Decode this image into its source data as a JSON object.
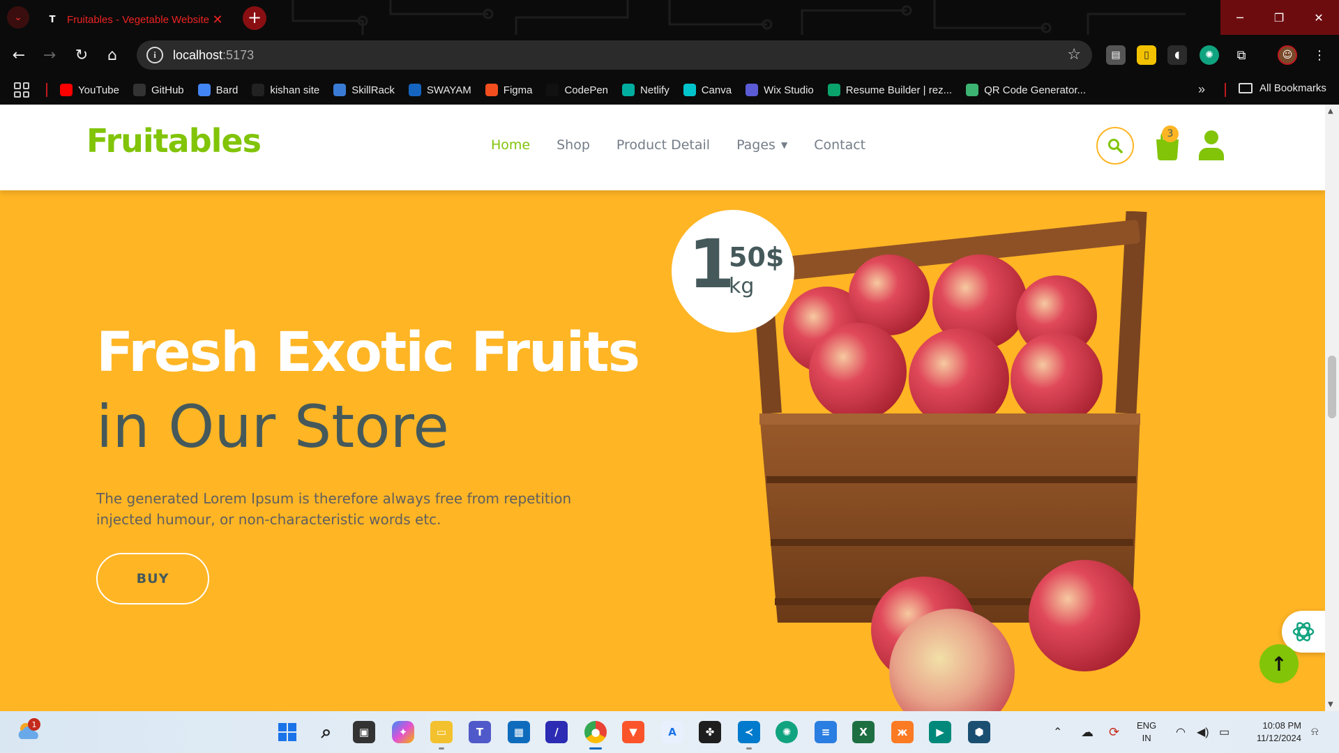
{
  "browser": {
    "tab_title": "Fruitables - Vegetable Website",
    "tab_favicon": "T",
    "address_host": "localhost",
    "address_port": ":5173",
    "bookmarks": [
      {
        "label": "YouTube",
        "icon": "youtube-icon",
        "color": "#ff0000"
      },
      {
        "label": "GitHub",
        "icon": "github-icon",
        "color": "#333333"
      },
      {
        "label": "Bard",
        "icon": "bard-icon",
        "color": "#4285f4"
      },
      {
        "label": "kishan site",
        "icon": "k-icon",
        "color": "#222222"
      },
      {
        "label": "SkillRack",
        "icon": "skillrack-icon",
        "color": "#3a7bd5"
      },
      {
        "label": "SWAYAM",
        "icon": "swayam-icon",
        "color": "#1565c0"
      },
      {
        "label": "Figma",
        "icon": "figma-icon",
        "color": "#f24e1e"
      },
      {
        "label": "CodePen",
        "icon": "codepen-icon",
        "color": "#111111"
      },
      {
        "label": "Netlify",
        "icon": "netlify-icon",
        "color": "#00ad9f"
      },
      {
        "label": "Canva",
        "icon": "canva-icon",
        "color": "#00c4cc"
      },
      {
        "label": "Wix Studio",
        "icon": "wix-icon",
        "color": "#5b5bd6"
      },
      {
        "label": "Resume Builder | rez...",
        "icon": "rezi-icon",
        "color": "#0aa36c"
      },
      {
        "label": "QR Code Generator...",
        "icon": "qr-icon",
        "color": "#3cb371"
      }
    ],
    "all_bookmarks": "All Bookmarks"
  },
  "site": {
    "logo": "Fruitables",
    "menu": [
      "Home",
      "Shop",
      "Product Detail",
      "Pages",
      "Contact"
    ],
    "active_menu": "Home",
    "cart_count": "3",
    "accent_green": "#81c408",
    "accent_yellow": "#ffb524",
    "dark_text": "#45595b"
  },
  "hero": {
    "title": "Fresh Exotic Fruits",
    "subtitle": "in Our Store",
    "text": "The generated Lorem Ipsum is therefore always free from repetition injected humour, or non-characteristic words etc.",
    "button": "BUY",
    "price_whole": "1",
    "price_fraction": "50$",
    "price_unit": "kg"
  },
  "taskbar": {
    "weather_badge": "1",
    "lang_top": "ENG",
    "lang_bottom": "IN",
    "time": "10:08 PM",
    "date": "11/12/2024"
  }
}
